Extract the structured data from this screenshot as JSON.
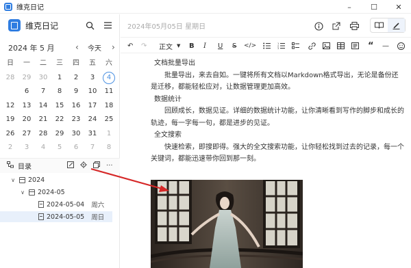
{
  "window": {
    "title": "维克日记",
    "controls": [
      "–",
      "☐",
      "✕"
    ]
  },
  "sidebar": {
    "brand": "维克日记",
    "calendar": {
      "title": "2024 年 5 月",
      "today_label": "今天",
      "weekdays": [
        "日",
        "一",
        "二",
        "三",
        "四",
        "五",
        "六"
      ],
      "weeks": [
        [
          "28",
          "29",
          "30",
          "1",
          "2",
          "3",
          "4"
        ],
        [
          "5",
          "6",
          "7",
          "8",
          "9",
          "10",
          "11"
        ],
        [
          "12",
          "13",
          "14",
          "15",
          "16",
          "17",
          "18"
        ],
        [
          "19",
          "20",
          "21",
          "22",
          "23",
          "24",
          "25"
        ],
        [
          "26",
          "27",
          "28",
          "29",
          "30",
          "31",
          "1"
        ],
        [
          "2",
          "3",
          "4",
          "5",
          "6",
          "7",
          "8"
        ]
      ],
      "selected": "5",
      "today": "4"
    },
    "toc": {
      "label": "目录"
    },
    "tree": {
      "year": "2024",
      "month": "2024-05",
      "entries": [
        {
          "date": "2024-05-04",
          "day": "周六"
        },
        {
          "date": "2024-05-05",
          "day": "周日"
        }
      ]
    }
  },
  "main": {
    "date_label": "2024年05月05日 星期日",
    "toolbar": {
      "style_label": "正文",
      "bold": "B",
      "italic": "I",
      "underline": "U",
      "strike": "S",
      "code": "</>"
    },
    "content": [
      {
        "type": "heading",
        "text": "文档批量导出"
      },
      {
        "type": "para",
        "text": "批量导出，来去自如。一键将所有文档以Markdown格式导出，无论是备份还是迁移，都能轻松应对，让数据管理更加高效。"
      },
      {
        "type": "heading",
        "text": "数据统计"
      },
      {
        "type": "para",
        "text": "回顾成长，数据见证。详细的数据统计功能，让你清晰看到写作的脚步和成长的轨迹，每一字每一句，都是进步的见证。"
      },
      {
        "type": "heading",
        "text": "全文搜索"
      },
      {
        "type": "para",
        "text": "快速检索，即搜即得。强大的全文搜索功能，让你轻松找到过去的记录，每一个关键词，都能迅速带你回到那一刻。"
      }
    ]
  },
  "colors": {
    "accent": "#4a90e2",
    "arrow": "#d62828"
  }
}
